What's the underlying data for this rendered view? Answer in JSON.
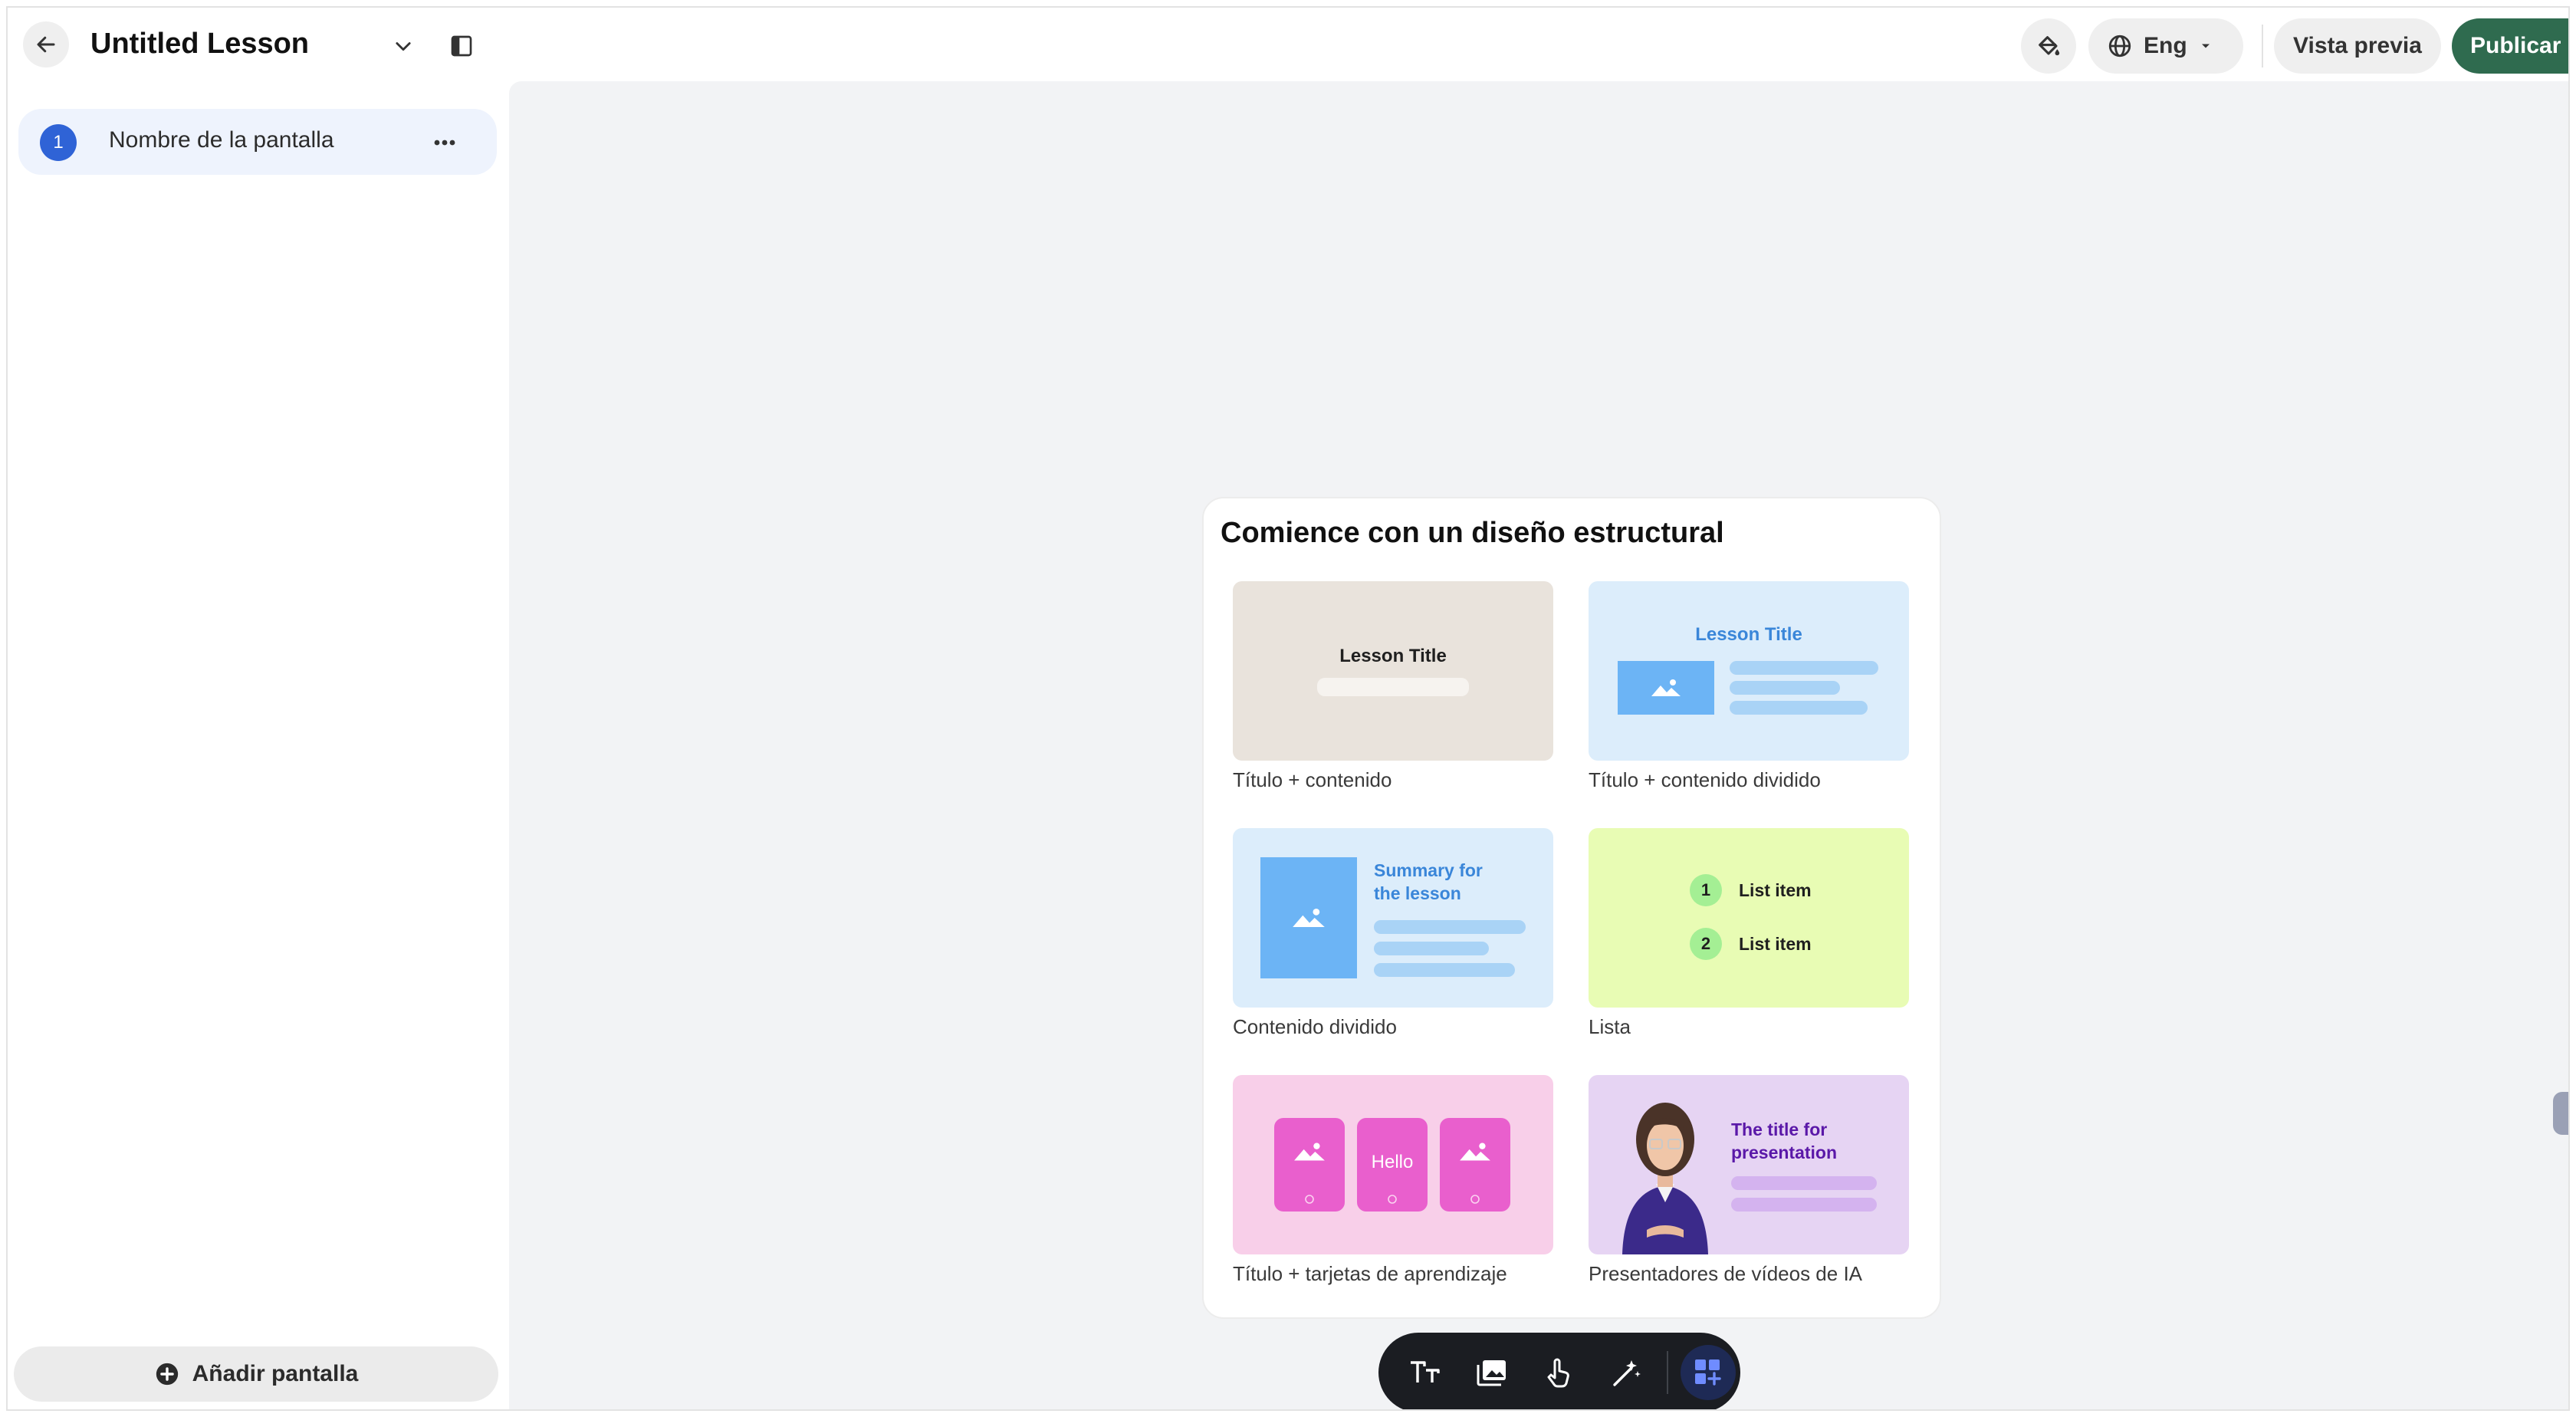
{
  "header": {
    "lesson_title": "Untitled Lesson",
    "language": "Eng",
    "preview_label": "Vista previa",
    "publish_label": "Publicar"
  },
  "sidebar": {
    "screens": [
      {
        "number": "1",
        "name": "Nombre de la pantalla"
      }
    ],
    "add_screen_label": "Añadir pantalla"
  },
  "layout_picker": {
    "title": "Comience con un diseño estructural",
    "tiles": [
      {
        "label": "Título + contenido",
        "preview_title": "Lesson Title"
      },
      {
        "label": "Título + contenido dividido",
        "preview_title": "Lesson Title"
      },
      {
        "label": "Contenido dividido",
        "preview_title": "Summary for the lesson"
      },
      {
        "label": "Lista",
        "item1_num": "1",
        "item1": "List item",
        "item2_num": "2",
        "item2": "List item"
      },
      {
        "label": "Título + tarjetas de aprendizaje",
        "card_text": "Hello"
      },
      {
        "label": "Presentadores de vídeos de IA",
        "preview_title": "The title for presentation"
      }
    ]
  },
  "toolbar": {
    "tools": [
      "text-icon",
      "media-icon",
      "interaction-icon",
      "ai-wand-icon",
      "layout-add-icon"
    ]
  },
  "colors": {
    "publish": "#2f6b4f",
    "accent_blue": "#2f63d6",
    "canvas_bg": "#f2f3f5",
    "toolbar_bg": "#1b1d22"
  }
}
